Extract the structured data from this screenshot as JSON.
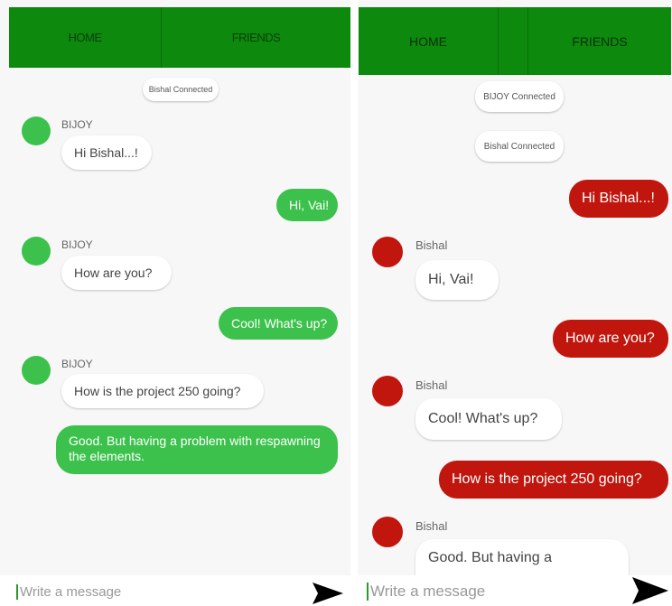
{
  "left": {
    "tabs": {
      "home": "HOME",
      "friends": "FRIENDS"
    },
    "system": [
      "Bishal Connected"
    ],
    "messages": [
      {
        "sender": "BIJOY",
        "text": "Hi Bishal...!"
      },
      {
        "text": "Hi, Vai!"
      },
      {
        "sender": "BIJOY",
        "text": "How are you?"
      },
      {
        "text": "Cool! What's up?"
      },
      {
        "sender": "BIJOY",
        "text": "How is the project 250 going?"
      },
      {
        "text": "Good. But having a problem with respawning the elements."
      }
    ],
    "input_placeholder": "Write a message",
    "accent": "#3cc24c"
  },
  "right": {
    "tabs": {
      "home": "HOME",
      "friends": "FRIENDS"
    },
    "system": [
      "BIJOY Connected",
      "Bishal Connected"
    ],
    "messages": [
      {
        "text": "Hi Bishal...!"
      },
      {
        "sender": "Bishal",
        "text": "Hi, Vai!"
      },
      {
        "text": "How are you?"
      },
      {
        "sender": "Bishal",
        "text": "Cool! What's up?"
      },
      {
        "text": "How is the project 250 going?"
      },
      {
        "sender": "Bishal",
        "text": "Good. But having a"
      }
    ],
    "input_placeholder": "Write a message",
    "accent": "#c0160e"
  },
  "colors": {
    "tabbar": "#0d8a0d",
    "background": "#f7f7f7"
  },
  "icons": {
    "send": "send-arrow-icon"
  }
}
